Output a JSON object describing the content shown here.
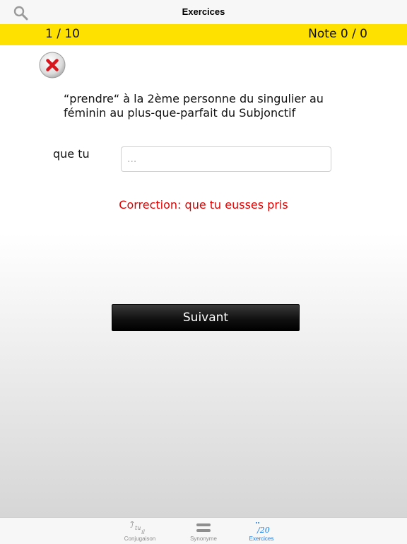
{
  "nav": {
    "title": "Exercices"
  },
  "score": {
    "progress": "1 / 10",
    "note": "Note 0 / 0"
  },
  "exercise": {
    "question": "“prendre“ à la 2ème personne du singulier au féminin au plus-que-parfait du Subjonctif",
    "prompt": "que tu",
    "input_value": "",
    "input_placeholder": "...",
    "correction": "Correction: que tu eusses pris",
    "next_label": "Suivant"
  },
  "tabs": [
    {
      "label": "Conjugaison",
      "icon": "conjugation-icon",
      "active": false
    },
    {
      "label": "Synonyme",
      "icon": "equals-icon",
      "active": false
    },
    {
      "label": "Exercices",
      "icon": "score-icon",
      "active": true,
      "icon_text": "/20"
    }
  ],
  "colors": {
    "scorebar": "#ffe100",
    "correction": "#e00000",
    "active_tab": "#1a7ae6",
    "wrong_icon": "#d8141c"
  }
}
